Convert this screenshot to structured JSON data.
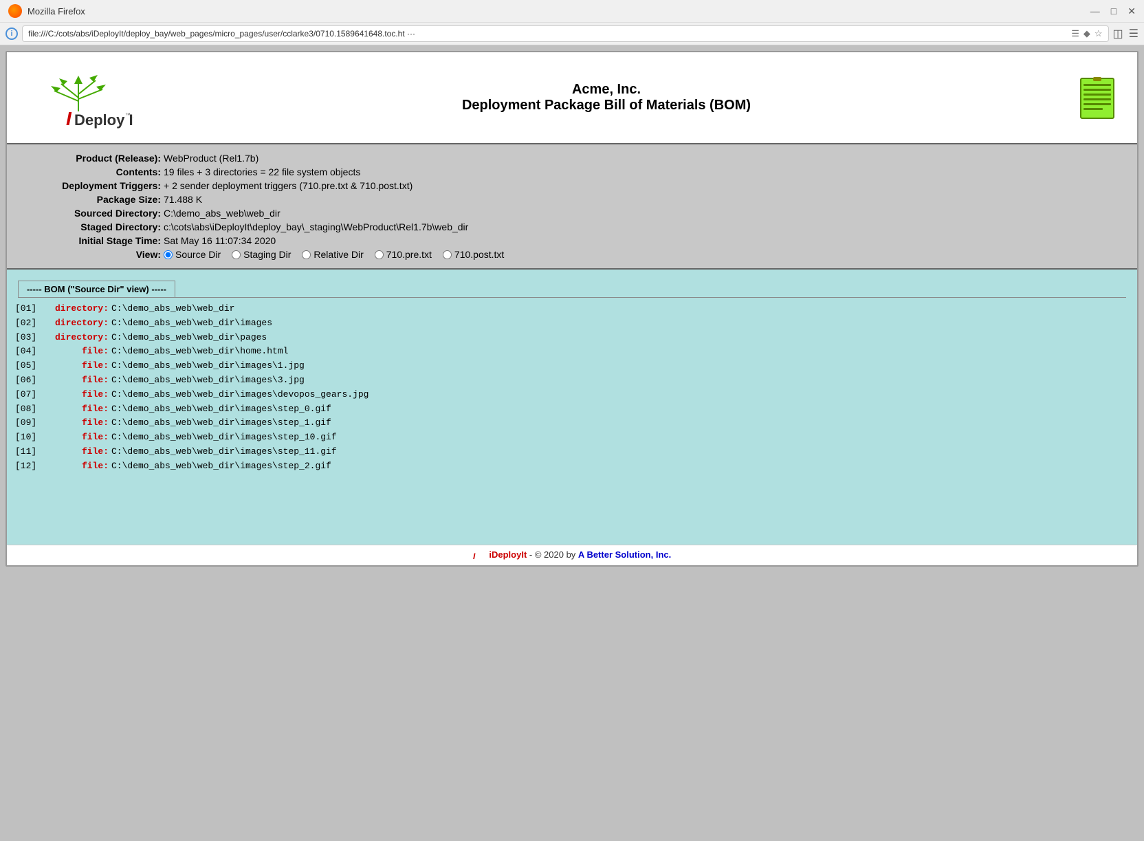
{
  "browser": {
    "title": "Mozilla Firefox",
    "url": "file:///C:/cots/abs/iDeployIt/deploy_bay/web_pages/micro_pages/user/cclarke3/0710.1589641648.toc.ht ···",
    "url_full": "file:///C:/cots/abs/iDeployIt/deploy_bay/web_pages/micro_pages/user/cclarke3/0710.1589641648.toc.ht"
  },
  "header": {
    "company": "Acme, Inc.",
    "doc_title": "Deployment Package Bill of Materials (BOM)"
  },
  "info": {
    "product_label": "Product (Release):",
    "product_value": "WebProduct (Rel1.7b)",
    "contents_label": "Contents:",
    "contents_value": "19 files + 3 directories = 22 file system objects",
    "triggers_label": "Deployment Triggers:",
    "triggers_value": "+ 2 sender deployment triggers (710.pre.txt & 710.post.txt)",
    "size_label": "Package Size:",
    "size_value": "71.488 K",
    "source_label": "Sourced Directory:",
    "source_value": "C:\\demo_abs_web\\web_dir",
    "staged_label": "Staged Directory:",
    "staged_value": "c:\\cots\\abs\\iDeployIt\\deploy_bay\\_staging\\WebProduct\\Rel1.7b\\web_dir",
    "time_label": "Initial Stage Time:",
    "time_value": "Sat May 16 11:07:34 2020",
    "view_label": "View:"
  },
  "view_options": [
    {
      "id": "source",
      "label": "Source Dir",
      "checked": true
    },
    {
      "id": "staging",
      "label": "Staging Dir",
      "checked": false
    },
    {
      "id": "relative",
      "label": "Relative Dir",
      "checked": false
    },
    {
      "id": "pre",
      "label": "710.pre.txt",
      "checked": false
    },
    {
      "id": "post",
      "label": "710.post.txt",
      "checked": false
    }
  ],
  "bom": {
    "tab_label": "----- BOM (\"Source Dir\" view) -----",
    "entries": [
      {
        "index": "[01]",
        "type": "directory:",
        "path": "C:\\demo_abs_web\\web_dir",
        "is_dir": true
      },
      {
        "index": "[02]",
        "type": "directory:",
        "path": "C:\\demo_abs_web\\web_dir\\images",
        "is_dir": true
      },
      {
        "index": "[03]",
        "type": "directory:",
        "path": "C:\\demo_abs_web\\web_dir\\pages",
        "is_dir": true
      },
      {
        "index": "[04]",
        "type": "file:",
        "path": "C:\\demo_abs_web\\web_dir\\home.html",
        "is_dir": false
      },
      {
        "index": "[05]",
        "type": "file:",
        "path": "C:\\demo_abs_web\\web_dir\\images\\1.jpg",
        "is_dir": false
      },
      {
        "index": "[06]",
        "type": "file:",
        "path": "C:\\demo_abs_web\\web_dir\\images\\3.jpg",
        "is_dir": false
      },
      {
        "index": "[07]",
        "type": "file:",
        "path": "C:\\demo_abs_web\\web_dir\\images\\devopos_gears.jpg",
        "is_dir": false
      },
      {
        "index": "[08]",
        "type": "file:",
        "path": "C:\\demo_abs_web\\web_dir\\images\\step_0.gif",
        "is_dir": false
      },
      {
        "index": "[09]",
        "type": "file:",
        "path": "C:\\demo_abs_web\\web_dir\\images\\step_1.gif",
        "is_dir": false
      },
      {
        "index": "[10]",
        "type": "file:",
        "path": "C:\\demo_abs_web\\web_dir\\images\\step_10.gif",
        "is_dir": false
      },
      {
        "index": "[11]",
        "type": "file:",
        "path": "C:\\demo_abs_web\\web_dir\\images\\step_11.gif",
        "is_dir": false
      },
      {
        "index": "[12]",
        "type": "file:",
        "path": "C:\\demo_abs_web\\web_dir\\images\\step_2.gif",
        "is_dir": false
      }
    ]
  },
  "footer": {
    "brand": "iDeployIt",
    "copy_text": " - © 2020 by ",
    "link_text": "A Better Solution, Inc."
  }
}
